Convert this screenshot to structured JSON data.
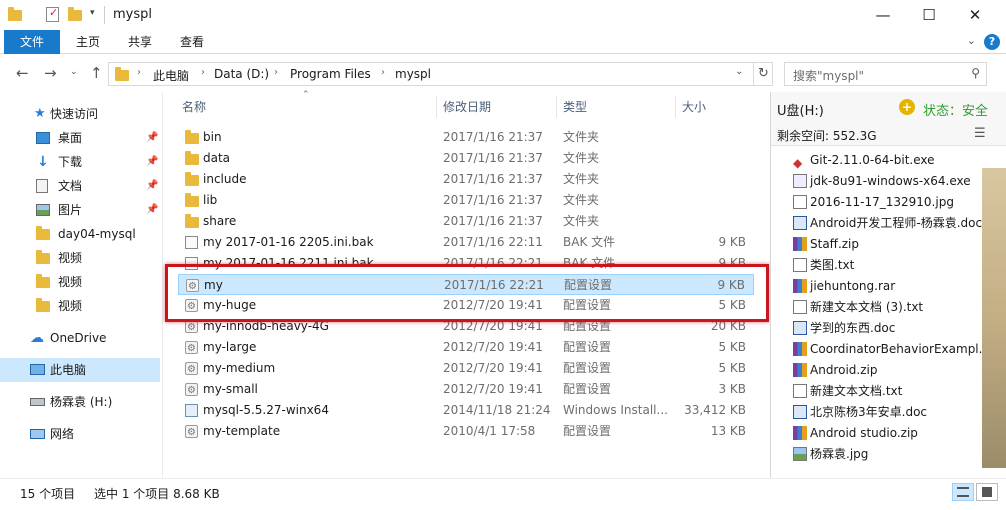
{
  "window": {
    "title": "myspl",
    "minimize": "—",
    "maximize": "☐",
    "close": "✕"
  },
  "ribbon": {
    "tabs": [
      "文件",
      "主页",
      "共享",
      "查看"
    ],
    "help": "?"
  },
  "address": {
    "crumbs": [
      "此电脑",
      "Data (D:)",
      "Program Files",
      "myspl"
    ],
    "search_placeholder": "搜索\"myspl\""
  },
  "nav": {
    "items": [
      {
        "label": "快速访问",
        "icon": "star-icon",
        "pinned": false
      },
      {
        "label": "桌面",
        "icon": "desktop-icon",
        "pinned": true
      },
      {
        "label": "下载",
        "icon": "download-icon",
        "pinned": true
      },
      {
        "label": "文档",
        "icon": "document-icon",
        "pinned": true
      },
      {
        "label": "图片",
        "icon": "picture-icon",
        "pinned": true
      },
      {
        "label": "day04-mysql",
        "icon": "folder-icon",
        "pinned": false
      },
      {
        "label": "视频",
        "icon": "folder-icon",
        "pinned": false
      },
      {
        "label": "视频",
        "icon": "folder-icon",
        "pinned": false
      },
      {
        "label": "视频",
        "icon": "folder-icon",
        "pinned": false
      },
      {
        "label": "OneDrive",
        "icon": "cloud-icon",
        "pinned": false
      },
      {
        "label": "此电脑",
        "icon": "computer-icon",
        "pinned": false
      },
      {
        "label": "杨霖袁 (H:)",
        "icon": "drive-icon",
        "pinned": false
      },
      {
        "label": "网络",
        "icon": "network-icon",
        "pinned": false
      }
    ]
  },
  "columns": {
    "name": "名称",
    "date": "修改日期",
    "type": "类型",
    "size": "大小"
  },
  "files": [
    {
      "name": "bin",
      "date": "2017/1/16 21:37",
      "type": "文件夹",
      "size": "",
      "icon": "folder-icon"
    },
    {
      "name": "data",
      "date": "2017/1/16 21:37",
      "type": "文件夹",
      "size": "",
      "icon": "folder-icon"
    },
    {
      "name": "include",
      "date": "2017/1/16 21:37",
      "type": "文件夹",
      "size": "",
      "icon": "folder-icon"
    },
    {
      "name": "lib",
      "date": "2017/1/16 21:37",
      "type": "文件夹",
      "size": "",
      "icon": "folder-icon"
    },
    {
      "name": "share",
      "date": "2017/1/16 21:37",
      "type": "文件夹",
      "size": "",
      "icon": "folder-icon"
    },
    {
      "name": "my 2017-01-16 2205.ini.bak",
      "date": "2017/1/16 22:11",
      "type": "BAK 文件",
      "size": "9 KB",
      "icon": "file-icon"
    },
    {
      "name": "my 2017-01-16 2211.ini.bak",
      "date": "2017/1/16 22:21",
      "type": "BAK 文件",
      "size": "9 KB",
      "icon": "file-icon"
    },
    {
      "name": "my",
      "date": "2017/1/16 22:21",
      "type": "配置设置",
      "size": "9 KB",
      "icon": "config-icon"
    },
    {
      "name": "my-huge",
      "date": "2012/7/20 19:41",
      "type": "配置设置",
      "size": "5 KB",
      "icon": "config-icon"
    },
    {
      "name": "my-innodb-heavy-4G",
      "date": "2012/7/20 19:41",
      "type": "配置设置",
      "size": "20 KB",
      "icon": "config-icon"
    },
    {
      "name": "my-large",
      "date": "2012/7/20 19:41",
      "type": "配置设置",
      "size": "5 KB",
      "icon": "config-icon"
    },
    {
      "name": "my-medium",
      "date": "2012/7/20 19:41",
      "type": "配置设置",
      "size": "5 KB",
      "icon": "config-icon"
    },
    {
      "name": "my-small",
      "date": "2012/7/20 19:41",
      "type": "配置设置",
      "size": "3 KB",
      "icon": "config-icon"
    },
    {
      "name": "mysql-5.5.27-winx64",
      "date": "2014/11/18 21:24",
      "type": "Windows Install...",
      "size": "33,412 KB",
      "icon": "installer-icon"
    },
    {
      "name": "my-template",
      "date": "2010/4/1 17:58",
      "type": "配置设置",
      "size": "13 KB",
      "icon": "config-icon"
    }
  ],
  "preview": {
    "drive": "U盘(H:)",
    "safe_status": "状态：安全",
    "free_space": "剩余空间: 552.3G",
    "items": [
      {
        "label": "Git-2.11.0-64-bit.exe",
        "icon": "exe-icon"
      },
      {
        "label": "jdk-8u91-windows-x64.exe",
        "icon": "exe-icon"
      },
      {
        "label": "2016-11-17_132910.jpg",
        "icon": "image-icon"
      },
      {
        "label": "Android开发工程师-杨霖袁.doc",
        "icon": "word-icon"
      },
      {
        "label": "Staff.zip",
        "icon": "archive-icon"
      },
      {
        "label": "类图.txt",
        "icon": "text-icon"
      },
      {
        "label": "jiehuntong.rar",
        "icon": "archive-icon"
      },
      {
        "label": "新建文本文档 (3).txt",
        "icon": "text-icon"
      },
      {
        "label": "学到的东西.doc",
        "icon": "word-icon"
      },
      {
        "label": "CoordinatorBehaviorExampl...",
        "icon": "archive-icon"
      },
      {
        "label": "Android.zip",
        "icon": "archive-icon"
      },
      {
        "label": "新建文本文档.txt",
        "icon": "text-icon"
      },
      {
        "label": "北京陈杨3年安卓.doc",
        "icon": "word-icon"
      },
      {
        "label": "Android studio.zip",
        "icon": "archive-icon"
      },
      {
        "label": "杨霖袁.jpg",
        "icon": "image-icon"
      }
    ]
  },
  "status": {
    "count": "15 个项目",
    "selected": "选中 1 个项目  8.68 KB"
  },
  "colors": {
    "accent": "#1979ca",
    "selection": "#cce8ff",
    "highlight_box": "#c8161d",
    "folder": "#e8b93a",
    "safe_green": "#2e9c2e"
  }
}
